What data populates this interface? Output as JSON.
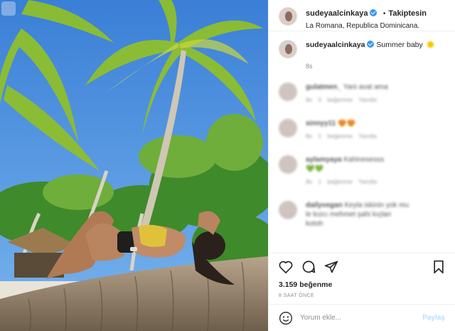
{
  "header": {
    "username": "sudeyaalcinkaya",
    "separator": "•",
    "follow_status": "Takiptesin",
    "location": "La Romana, Republica Dominicana."
  },
  "caption": {
    "username": "sudeyaalcinkaya",
    "text": "Summer baby",
    "emoji": "sun-emoji",
    "time": "8s"
  },
  "comments": [
    {
      "user": "gulatmen_",
      "text": "Yani avat ama",
      "meta": "8s  3 beğenme  Yanıtla"
    },
    {
      "user": "sinnyy11",
      "text": "😍😍",
      "meta": "8s  1 beğenme  Yanıtla"
    },
    {
      "user": "aylamyaya",
      "text": "Kahinesesss",
      "text2": "💚💚",
      "meta": "8s  1 beğenme  Yanıtla"
    },
    {
      "user": "dailyvegan",
      "text": "Keyla iskinin yok mu",
      "text2": "le kızcı mehmet şahi kıçlari",
      "text3": "kotoh",
      "meta": ""
    }
  ],
  "actions": {
    "likes": "3.159 beğenme",
    "posted": "8 SAAT ÖNCE"
  },
  "comment_box": {
    "placeholder": "Yorum ekle...",
    "post_label": "Paylaş"
  },
  "colors": {
    "link_blue": "#3897f0",
    "post_disabled": "#b2dffc",
    "muted": "#8e8e8e"
  }
}
